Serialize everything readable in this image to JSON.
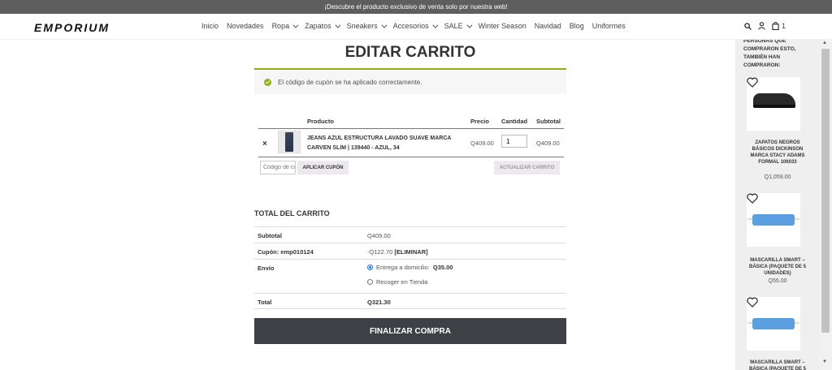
{
  "announcement": "¡Descubre el producto exclusivo de venta solo por nuestra web!",
  "logo": "EMPORIUM",
  "nav": [
    {
      "label": "Inicio",
      "dropdown": false
    },
    {
      "label": "Novedades",
      "dropdown": false
    },
    {
      "label": "Ropa",
      "dropdown": true
    },
    {
      "label": "Zapatos",
      "dropdown": true
    },
    {
      "label": "Sneakers",
      "dropdown": true
    },
    {
      "label": "Accesorios",
      "dropdown": true
    },
    {
      "label": "SALE",
      "dropdown": true
    },
    {
      "label": "Winter Season",
      "dropdown": false
    },
    {
      "label": "Navidad",
      "dropdown": false
    },
    {
      "label": "Blog",
      "dropdown": false
    },
    {
      "label": "Uniformes",
      "dropdown": false
    }
  ],
  "header": {
    "cart_count": "1",
    "icons": [
      "search-icon",
      "user-icon",
      "shopping-bag-icon"
    ]
  },
  "page_title": "EDITAR CARRITO",
  "notice": {
    "text": "El código de cupón se ha aplicado correctamente.",
    "color": "#8fae1b"
  },
  "cart": {
    "columns": {
      "product": "Producto",
      "price": "Precio",
      "quantity": "Cantidad",
      "subtotal": "Subtotal"
    },
    "items": [
      {
        "name": "JEANS AZUL ESTRUCTURA LAVADO SUAVE MARCA CARVEN SLIM | 139440 - AZUL, 34",
        "price": "Q409.00",
        "quantity": "1",
        "subtotal": "Q409.00",
        "remove": "×"
      }
    ],
    "coupon_placeholder": "Código de cupón",
    "apply_coupon": "APLICAR CUPÓN",
    "update_cart": "ACTUALIZAR CARRITO"
  },
  "totals": {
    "title": "TOTAL DEL CARRITO",
    "subtotal_label": "Subtotal",
    "subtotal_value": "Q409.00",
    "coupon_label": "Cupón: emp010124",
    "coupon_value": "-Q122.70",
    "coupon_remove": "[ELIMINAR]",
    "shipping_label": "Envío",
    "shipping_options": [
      {
        "label": "Entrega a domicilio:",
        "amount": "Q35.00",
        "selected": true
      },
      {
        "label": "Recoger en Tienda",
        "amount": "",
        "selected": false
      }
    ],
    "total_label": "Total",
    "total_value": "Q321.30"
  },
  "checkout_button": "FINALIZAR COMPRA",
  "sidebar": {
    "heading": "PERSONAS QUE COMPRARON ESTO, TAMBIÉN HAN COMPRARON:",
    "products": [
      {
        "name": "ZAPATOS NEGROS BÁSICOS DICKINSON MARCA STACY ADAMS FORMAL 106033",
        "price": "Q1,059.00"
      },
      {
        "name": "MASCARILLA SMART – BÁSICA (PAQUETE DE 5 UNIDADES)",
        "price": "Q55.00"
      },
      {
        "name": "MASCARILLA SMART – BÁSICA (PAQUETE DE 5 UNIDADES)",
        "price": ""
      }
    ]
  }
}
